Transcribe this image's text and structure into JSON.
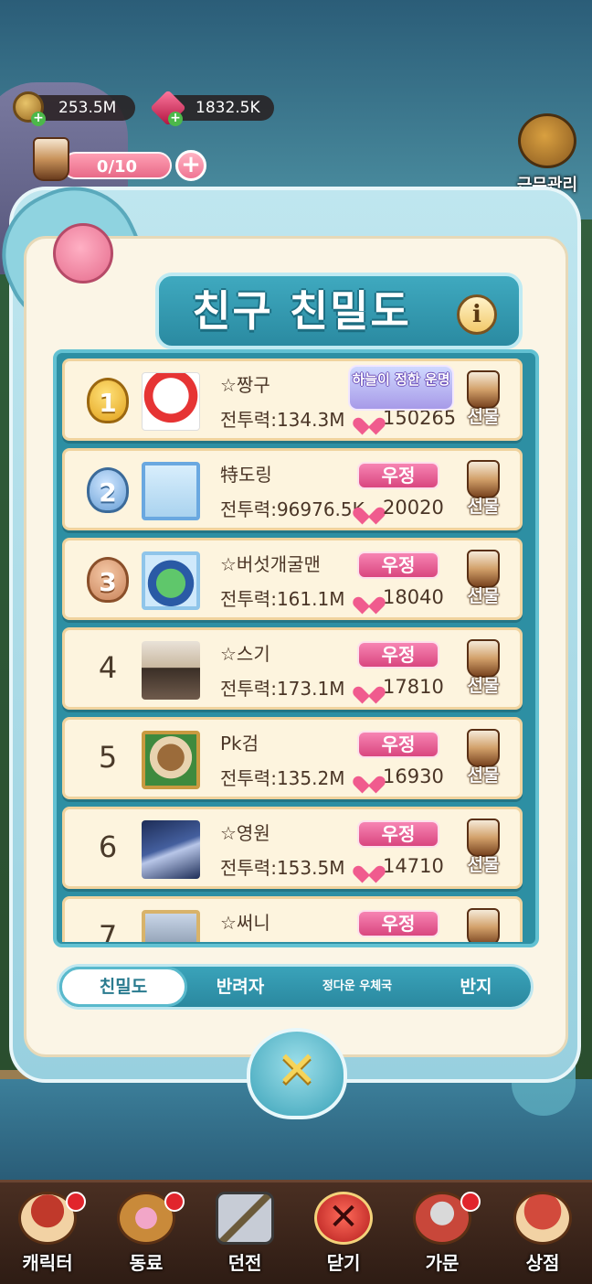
{
  "top_bar": {
    "coins": "253.5M",
    "gems": "1832.5K",
    "tea_meter": "0/10",
    "rose_meter": "0",
    "work_label": "근무관리"
  },
  "panel": {
    "title": "친구 친밀도",
    "info_label": "i"
  },
  "friends": [
    {
      "rank": "1",
      "name": "☆짱구",
      "power": "전투력:134.3M",
      "score": "150265",
      "tag": "하늘이 정한 운명",
      "gift": "선물"
    },
    {
      "rank": "2",
      "name": "特도링",
      "power": "전투력:96976.5K",
      "score": "20020",
      "tag": "우정",
      "gift": "선물"
    },
    {
      "rank": "3",
      "name": "☆버섯개굴맨",
      "power": "전투력:161.1M",
      "score": "18040",
      "tag": "우정",
      "gift": "선물"
    },
    {
      "rank": "4",
      "name": "☆스기",
      "power": "전투력:173.1M",
      "score": "17810",
      "tag": "우정",
      "gift": "선물"
    },
    {
      "rank": "5",
      "name": "Pk검",
      "power": "전투력:135.2M",
      "score": "16930",
      "tag": "우정",
      "gift": "선물"
    },
    {
      "rank": "6",
      "name": "☆영원",
      "power": "전투력:153.5M",
      "score": "14710",
      "tag": "우정",
      "gift": "선물"
    },
    {
      "rank": "7",
      "name": "☆써니",
      "tag": "우정"
    }
  ],
  "tabs": [
    {
      "label": "친밀도",
      "active": true
    },
    {
      "label": "반려자",
      "active": false
    },
    {
      "label": "정다운 우체국",
      "active": false
    },
    {
      "label": "반지",
      "active": false
    }
  ],
  "bottom_nav": [
    {
      "label": "캐릭터",
      "icon": "character-icon",
      "badge": true
    },
    {
      "label": "동료",
      "icon": "pet-paw-icon",
      "badge": true
    },
    {
      "label": "던전",
      "icon": "crossed-swords-icon",
      "badge": false
    },
    {
      "label": "닫기",
      "icon": "close-icon",
      "badge": false
    },
    {
      "label": "가문",
      "icon": "guild-skull-icon",
      "badge": true
    },
    {
      "label": "상점",
      "icon": "shop-icon",
      "badge": false
    }
  ],
  "colors": {
    "panel_blue": "#2d8fa3",
    "row_bg": "#fdf4de",
    "heart_pink": "#f05b8e",
    "tag_pink": "#d9467f"
  }
}
